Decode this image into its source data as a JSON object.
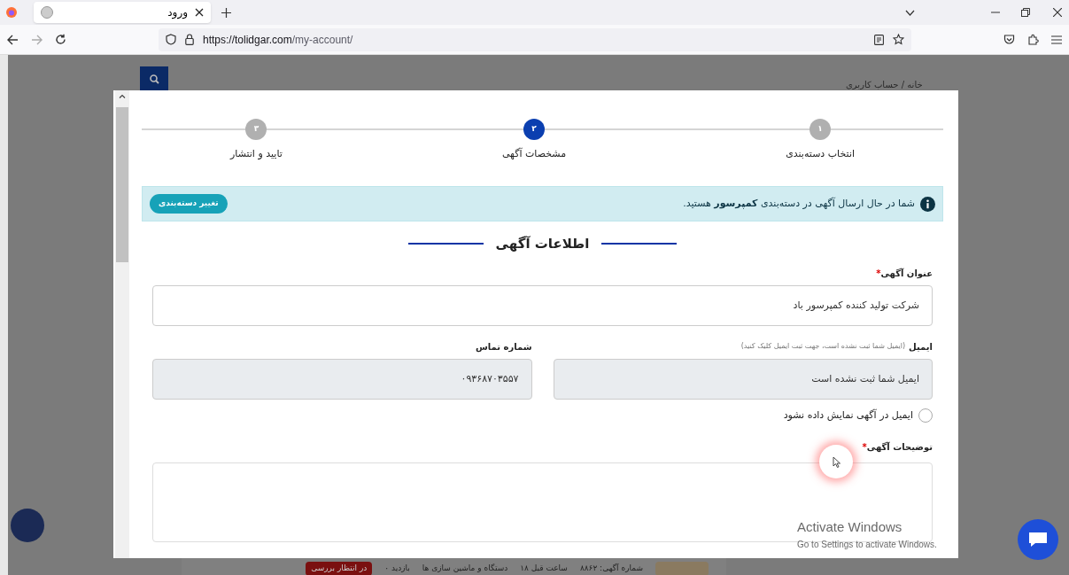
{
  "browser": {
    "tab_title": "ورود",
    "url_host": "https://tolidgar.com",
    "url_path": "/my-account/"
  },
  "page": {
    "breadcrumb": "خانه / حساب کاربری",
    "listing": {
      "ad_number": "شماره آگهی: ۸۸۶۲",
      "time": "۱۸ ساعت قبل",
      "category": "دستگاه و ماشین سازی ها",
      "views": "۰ بازدید",
      "status": "در انتظار بررسی"
    }
  },
  "modal": {
    "steps": [
      {
        "number": "۱",
        "label": "انتخاب دسته‌بندی",
        "selected": false
      },
      {
        "number": "۲",
        "label": "مشخصات آگهی",
        "selected": true
      },
      {
        "number": "۳",
        "label": "تایید و انتشار",
        "selected": false
      }
    ],
    "alert": {
      "text": "شما در حال ارسال آگهی در دسته‌بندی **کمپرسور** هستید.",
      "button": "تغییر دسته‌بندی"
    },
    "section_title": "اطلاعات آگهی",
    "title_field": {
      "label": "عنوان آگهی",
      "required_mark": "*",
      "value": "شرکت تولید کننده کمپرسور باد"
    },
    "email_field": {
      "label": "ایمیل",
      "hint": "(ایمیل شما ثبت نشده است، جهت ثبت ایمیل کلیک کنید)",
      "value": "ایمیل شما ثبت نشده است"
    },
    "phone_field": {
      "label": "شماره تماس",
      "value": "۰۹۳۶۸۷۰۳۵۵۷"
    },
    "hide_email": {
      "label": "ایمیل در آگهی نمایش داده نشود",
      "checked": false
    },
    "description_field": {
      "label": "توضیحات آگهی",
      "required_mark": "*"
    }
  },
  "os_notice": {
    "title": "Activate Windows",
    "subtitle": "Go to Settings to activate Windows."
  }
}
